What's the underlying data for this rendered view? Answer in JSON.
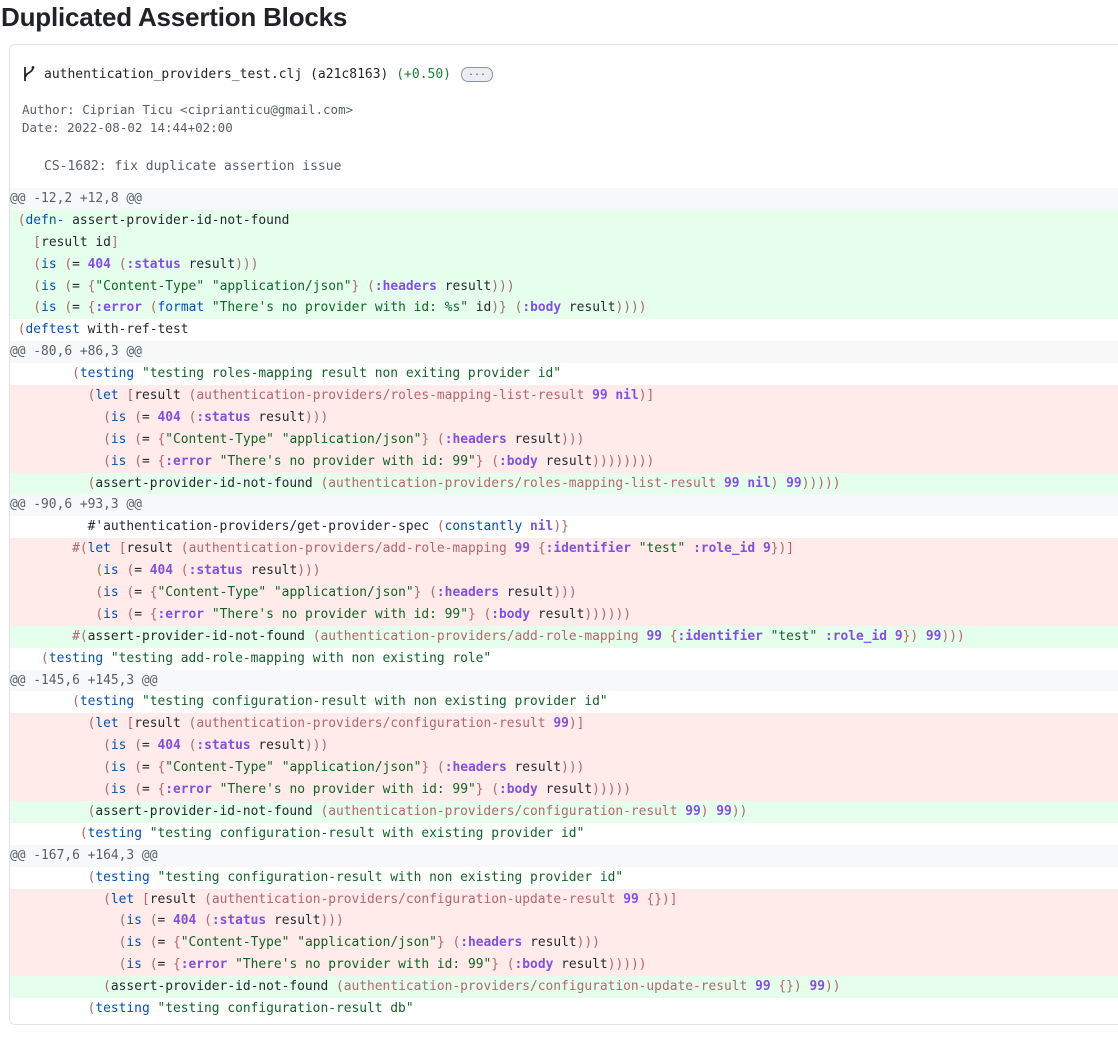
{
  "page": {
    "title": "Duplicated Assertion Blocks"
  },
  "commit": {
    "filename": "authentication_providers_test.clj",
    "hash": "(a21c8163)",
    "score": "(+0.50)",
    "more_label": "...",
    "author": "Author: Ciprian Ticu <ciprianticu@gmail.com>",
    "date": "Date: 2022-08-02 14:44+02:00",
    "message": "CS-1682: fix duplicate assertion issue"
  },
  "diff_lines": [
    {
      "type": "hunk",
      "text": "@@ -12,2 +12,8 @@"
    },
    {
      "type": "add",
      "text": " (defn- assert-provider-id-not-found"
    },
    {
      "type": "add",
      "text": "   [result id]"
    },
    {
      "type": "add",
      "text": "   (is (= 404 (:status result)))"
    },
    {
      "type": "add",
      "text": "   (is (= {\"Content-Type\" \"application/json\"} (:headers result)))"
    },
    {
      "type": "add",
      "text": "   (is (= {:error (format \"There's no provider with id: %s\" id)} (:body result))))"
    },
    {
      "type": "ctx",
      "text": " (deftest with-ref-test"
    },
    {
      "type": "hunk",
      "text": "@@ -80,6 +86,3 @@"
    },
    {
      "type": "ctx",
      "text": "        (testing \"testing roles-mapping result non exiting provider id\""
    },
    {
      "type": "del",
      "text": "          (let [result (authentication-providers/roles-mapping-list-result 99 nil)]"
    },
    {
      "type": "del",
      "text": "            (is (= 404 (:status result)))"
    },
    {
      "type": "del",
      "text": "            (is (= {\"Content-Type\" \"application/json\"} (:headers result)))"
    },
    {
      "type": "del",
      "text": "            (is (= {:error \"There's no provider with id: 99\"} (:body result))))))))"
    },
    {
      "type": "add",
      "text": "          (assert-provider-id-not-found (authentication-providers/roles-mapping-list-result 99 nil) 99)))))"
    },
    {
      "type": "hunk",
      "text": "@@ -90,6 +93,3 @@"
    },
    {
      "type": "ctx",
      "text": "          #'authentication-providers/get-provider-spec (constantly nil)}"
    },
    {
      "type": "del",
      "text": "        #(let [result (authentication-providers/add-role-mapping 99 {:identifier \"test\" :role_id 9})]"
    },
    {
      "type": "del",
      "text": "           (is (= 404 (:status result)))"
    },
    {
      "type": "del",
      "text": "           (is (= {\"Content-Type\" \"application/json\"} (:headers result)))"
    },
    {
      "type": "del",
      "text": "           (is (= {:error \"There's no provider with id: 99\"} (:body result))))))"
    },
    {
      "type": "add",
      "text": "        #(assert-provider-id-not-found (authentication-providers/add-role-mapping 99 {:identifier \"test\" :role_id 9}) 99)))"
    },
    {
      "type": "ctx",
      "text": "    (testing \"testing add-role-mapping with non existing role\""
    },
    {
      "type": "hunk",
      "text": "@@ -145,6 +145,3 @@"
    },
    {
      "type": "ctx",
      "text": "        (testing \"testing configuration-result with non existing provider id\""
    },
    {
      "type": "del",
      "text": "          (let [result (authentication-providers/configuration-result 99)]"
    },
    {
      "type": "del",
      "text": "            (is (= 404 (:status result)))"
    },
    {
      "type": "del",
      "text": "            (is (= {\"Content-Type\" \"application/json\"} (:headers result)))"
    },
    {
      "type": "del",
      "text": "            (is (= {:error \"There's no provider with id: 99\"} (:body result)))))"
    },
    {
      "type": "add",
      "text": "          (assert-provider-id-not-found (authentication-providers/configuration-result 99) 99))"
    },
    {
      "type": "ctx",
      "text": "         (testing \"testing configuration-result with existing provider id\""
    },
    {
      "type": "hunk",
      "text": "@@ -167,6 +164,3 @@"
    },
    {
      "type": "ctx",
      "text": "          (testing \"testing configuration-result with non existing provider id\""
    },
    {
      "type": "del",
      "text": "            (let [result (authentication-providers/configuration-update-result 99 {})]"
    },
    {
      "type": "del",
      "text": "              (is (= 404 (:status result)))"
    },
    {
      "type": "del",
      "text": "              (is (= {\"Content-Type\" \"application/json\"} (:headers result)))"
    },
    {
      "type": "del",
      "text": "              (is (= {:error \"There's no provider with id: 99\"} (:body result)))))"
    },
    {
      "type": "add",
      "text": "            (assert-provider-id-not-found (authentication-providers/configuration-update-result 99 {}) 99))"
    },
    {
      "type": "ctx",
      "text": "          (testing \"testing configuration-result db\""
    }
  ],
  "colors": {
    "added_bg": "#e6ffec",
    "removed_bg": "#ffebe9",
    "hunk_bg": "#f6f8fa",
    "score_positive": "#1a7f37"
  },
  "icons": {
    "file_icon": "git-branch-icon"
  }
}
